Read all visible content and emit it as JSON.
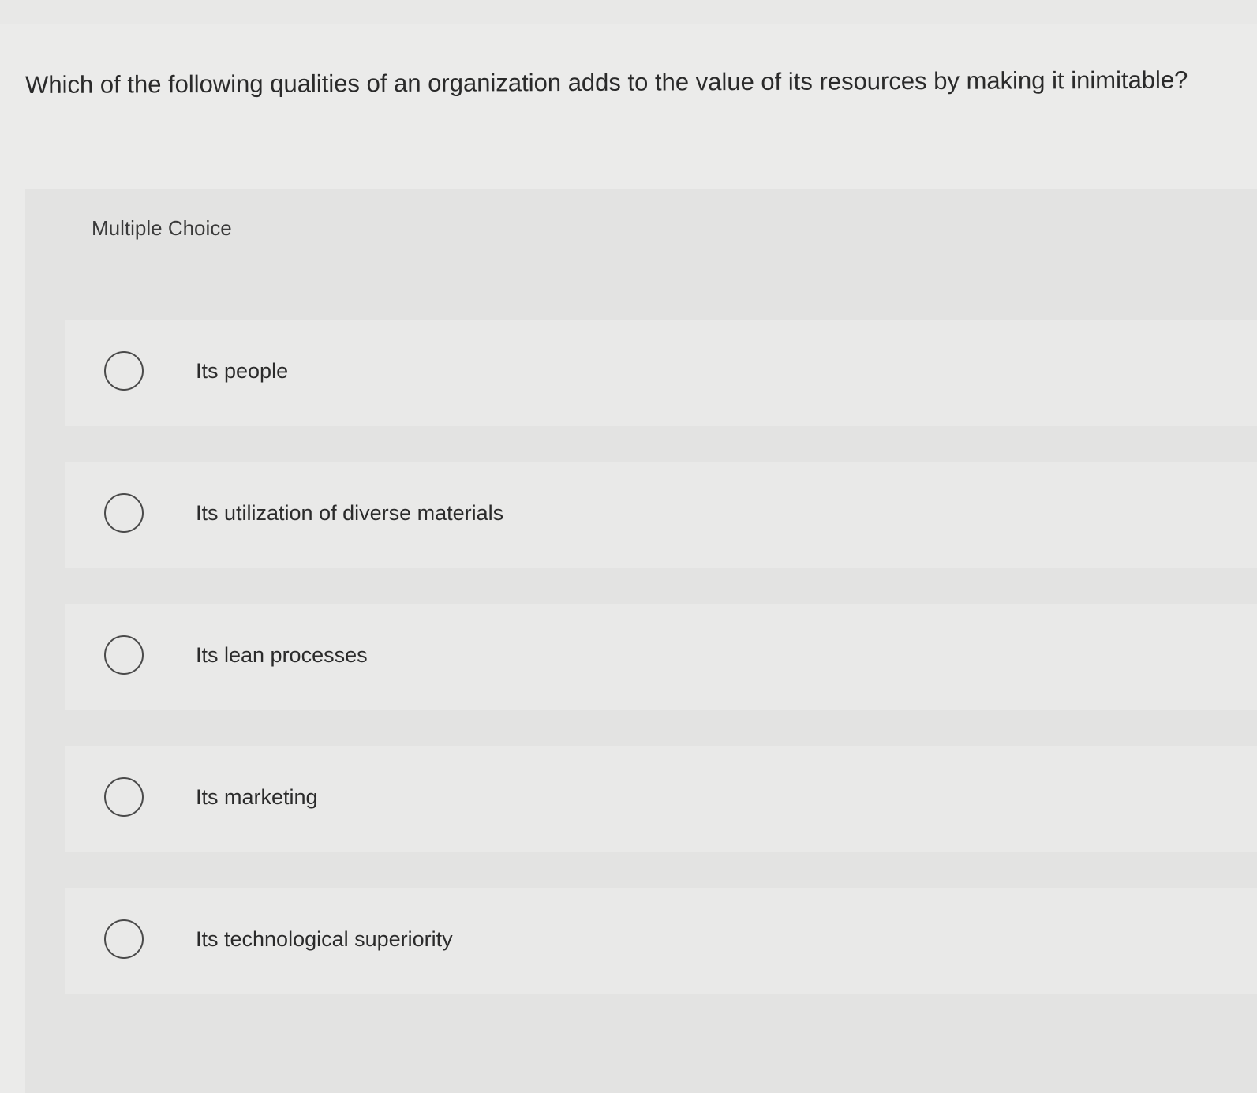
{
  "question": {
    "text": "Which of the following qualities of an organization adds to the value of its resources by making it inimitable?"
  },
  "panel": {
    "label": "Multiple Choice"
  },
  "options": [
    {
      "label": "Its people",
      "selected": false
    },
    {
      "label": "Its utilization of diverse materials",
      "selected": false
    },
    {
      "label": "Its lean processes",
      "selected": false
    },
    {
      "label": "Its marketing",
      "selected": false
    },
    {
      "label": "Its technological superiority",
      "selected": false
    }
  ]
}
